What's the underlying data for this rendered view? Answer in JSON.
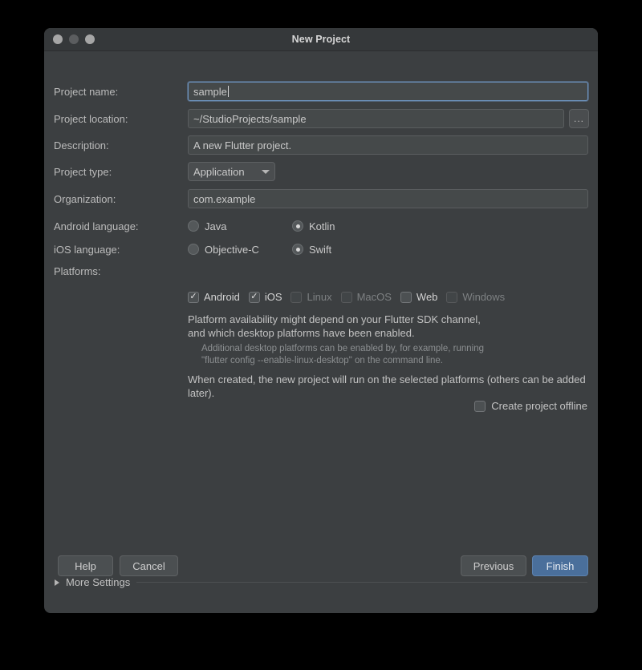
{
  "window": {
    "title": "New Project",
    "traffic_lights": [
      {
        "name": "close",
        "color": "#a6a6a6"
      },
      {
        "name": "minimize",
        "color": "#5b5d5f"
      },
      {
        "name": "maximize",
        "color": "#a6a6a6"
      }
    ]
  },
  "form": {
    "project_name": {
      "label": "Project name:",
      "value": "sample",
      "focused": true
    },
    "project_location": {
      "label": "Project location:",
      "value": "~/StudioProjects/sample",
      "browse_label": "..."
    },
    "description": {
      "label": "Description:",
      "value": "A new Flutter project."
    },
    "project_type": {
      "label": "Project type:",
      "value": "Application"
    },
    "organization": {
      "label": "Organization:",
      "value": "com.example"
    },
    "android_language": {
      "label": "Android language:",
      "options": [
        {
          "label": "Java",
          "selected": false
        },
        {
          "label": "Kotlin",
          "selected": true
        }
      ]
    },
    "ios_language": {
      "label": "iOS language:",
      "options": [
        {
          "label": "Objective-C",
          "selected": false
        },
        {
          "label": "Swift",
          "selected": true
        }
      ]
    },
    "platforms": {
      "label": "Platforms:",
      "options": [
        {
          "label": "Android",
          "checked": true,
          "disabled": false
        },
        {
          "label": "iOS",
          "checked": true,
          "disabled": false
        },
        {
          "label": "Linux",
          "checked": false,
          "disabled": true
        },
        {
          "label": "MacOS",
          "checked": false,
          "disabled": true
        },
        {
          "label": "Web",
          "checked": false,
          "disabled": false
        },
        {
          "label": "Windows",
          "checked": false,
          "disabled": true
        }
      ]
    },
    "offline": {
      "label": "Create project offline",
      "checked": false
    }
  },
  "notes": {
    "availability_line1": "Platform availability might depend on your Flutter SDK channel,",
    "availability_line2": "and which desktop platforms have been enabled.",
    "hint_line1": "Additional desktop platforms can be enabled by, for example, running",
    "hint_line2": "\"flutter config --enable-linux-desktop\" on the command line.",
    "created_note": "When created, the new project will run on the selected platforms (others can be added later)."
  },
  "more_settings": {
    "label": "More Settings",
    "expanded": false
  },
  "buttons": {
    "help": "Help",
    "cancel": "Cancel",
    "previous": "Previous",
    "finish": "Finish"
  },
  "colors": {
    "window_bg": "#3c3f41",
    "titlebar_bg": "#35383a",
    "field_bg": "#45494a",
    "accent": "#4a6f9b",
    "focus_ring": "#6d93bf"
  }
}
